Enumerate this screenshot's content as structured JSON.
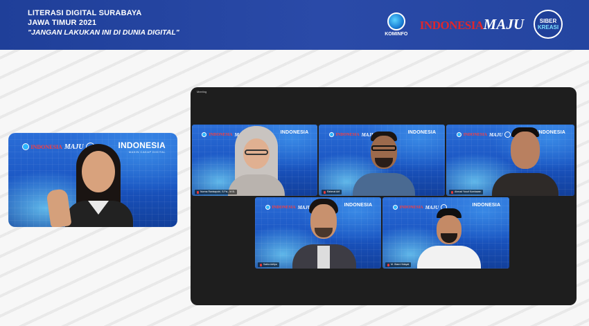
{
  "banner": {
    "line1": "LITERASI DIGITAL SURABAYA",
    "line2": "JAWA TIMUR 2021",
    "tagline": "\"JANGAN LAKUKAN INI DI DUNIA DIGITAL\"",
    "logos": {
      "kominfo": "KOMINFO",
      "indonesia": "INDONESIA",
      "maju": "MAJU",
      "siber": "SIBER",
      "kreasi": "KREASI"
    }
  },
  "host": {
    "vbg_indonesia": "INDONESIA",
    "vbg_maju": "MAJU",
    "vbg_brand": "INDONESIA",
    "vbg_brand_sub": "MAKIN CAKAP DIGITAL"
  },
  "zoom": {
    "window_title": "Meeting",
    "participants": [
      {
        "name": "Nurma Ranisaputri, S.Psi., M.Si.",
        "vbg_indonesia": "INDONESIA",
        "vbg_maju": "MAJU",
        "vbg_brand": "INDONESIA"
      },
      {
        "name": "Rahmat Arif",
        "vbg_indonesia": "INDONESIA",
        "vbg_maju": "MAJU",
        "vbg_brand": "INDONESIA"
      },
      {
        "name": "Ahmad Yusuf Kurniawan",
        "vbg_indonesia": "INDONESIA",
        "vbg_maju": "MAJU",
        "vbg_brand": "INDONESIA"
      },
      {
        "name": "Satria Aditya",
        "vbg_indonesia": "INDONESIA",
        "vbg_maju": "MAJU",
        "vbg_brand": "INDONESIA"
      },
      {
        "name": "M. Ilham Hidayat",
        "vbg_indonesia": "INDONESIA",
        "vbg_maju": "MAJU",
        "vbg_brand": "INDONESIA"
      }
    ]
  },
  "colors": {
    "banner_blue": "#2445a0",
    "indonesia_red": "#e0262b",
    "zoom_dark": "#1e1e1e",
    "vbg_blue": "#1a55c2"
  }
}
